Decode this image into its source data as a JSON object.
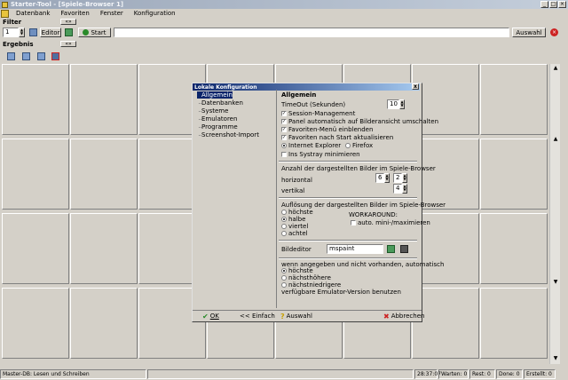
{
  "window": {
    "title": "Starter-Tool - [Spiele-Browser 1]"
  },
  "menu": [
    "Datenbank",
    "Favoriten",
    "Fenster",
    "Konfiguration"
  ],
  "filter": {
    "header": "Filter",
    "collapse_label": "«»",
    "number_value": "1",
    "editor_label": "Editor",
    "start_label": "Start",
    "search_value": "",
    "auswahl_label": "Auswahl"
  },
  "ergebnis": {
    "header": "Ergebnis",
    "collapse_label": "«»"
  },
  "grid": {
    "rows": 4,
    "cols": 8
  },
  "statusbar": {
    "db": "Master-DB: Lesen und Schreiben",
    "time": "28:37:07",
    "waiting": "Warten: 0",
    "rest": "Rest: 0",
    "done": "Done: 0",
    "created": "Erstellt: 0"
  },
  "dialog": {
    "title": "Lokale Konfiguration",
    "close": "x",
    "tree": [
      "Allgemein",
      "Datenbanken",
      "Systeme",
      "Emulatoren",
      "Programme",
      "Screenshot-Import"
    ],
    "tree_selected": 0,
    "section_title": "Allgemein",
    "timeout_label": "TimeOut (Sekunden)",
    "timeout_value": "10",
    "checks": [
      {
        "label": "Session-Management",
        "checked": true
      },
      {
        "label": "Panel automatisch auf Bilderansicht umschalten",
        "checked": true
      },
      {
        "label": "Favoriten-Menü einblenden",
        "checked": true
      },
      {
        "label": "Favoriten nach Start aktualisieren",
        "checked": true
      }
    ],
    "browser_ie": "Internet Explorer",
    "browser_ff": "Firefox",
    "systray_label": "Ins Systray minimieren",
    "count_title": "Anzahl der dargestellten Bilder im Spiele-Browser",
    "horizontal_label": "horizontal",
    "vertical_label": "vertikal",
    "h_value1": "6",
    "h_value2": "2",
    "v_value": "4",
    "resolution_title": "Auflösung der dargestellten Bilder im Spiele-Browser",
    "res_options": [
      "höchste",
      "halbe",
      "viertel",
      "achtel"
    ],
    "res_selected": 1,
    "workaround_label": "WORKAROUND:",
    "workaround_check": "auto. mini-/maximieren",
    "bildeditor_label": "Bildeditor",
    "bildeditor_value": "mspaint",
    "emu_title": "wenn angegeben und nicht vorhanden, automatisch",
    "emu_options": [
      "höchste",
      "nächsthöhere",
      "nächstniedrigere"
    ],
    "emu_selected": 0,
    "emu_footer": "verfügbare Emulator-Version benutzen",
    "buttons": {
      "ok": "OK",
      "simple": "<< Einfach",
      "select": "Auswahl",
      "cancel": "Abbrechen"
    }
  },
  "colors": {
    "selection": "#0a246a",
    "background": "#d4d0c8",
    "cancel_red": "#cc2222",
    "ok_green": "#2a8a2a"
  }
}
